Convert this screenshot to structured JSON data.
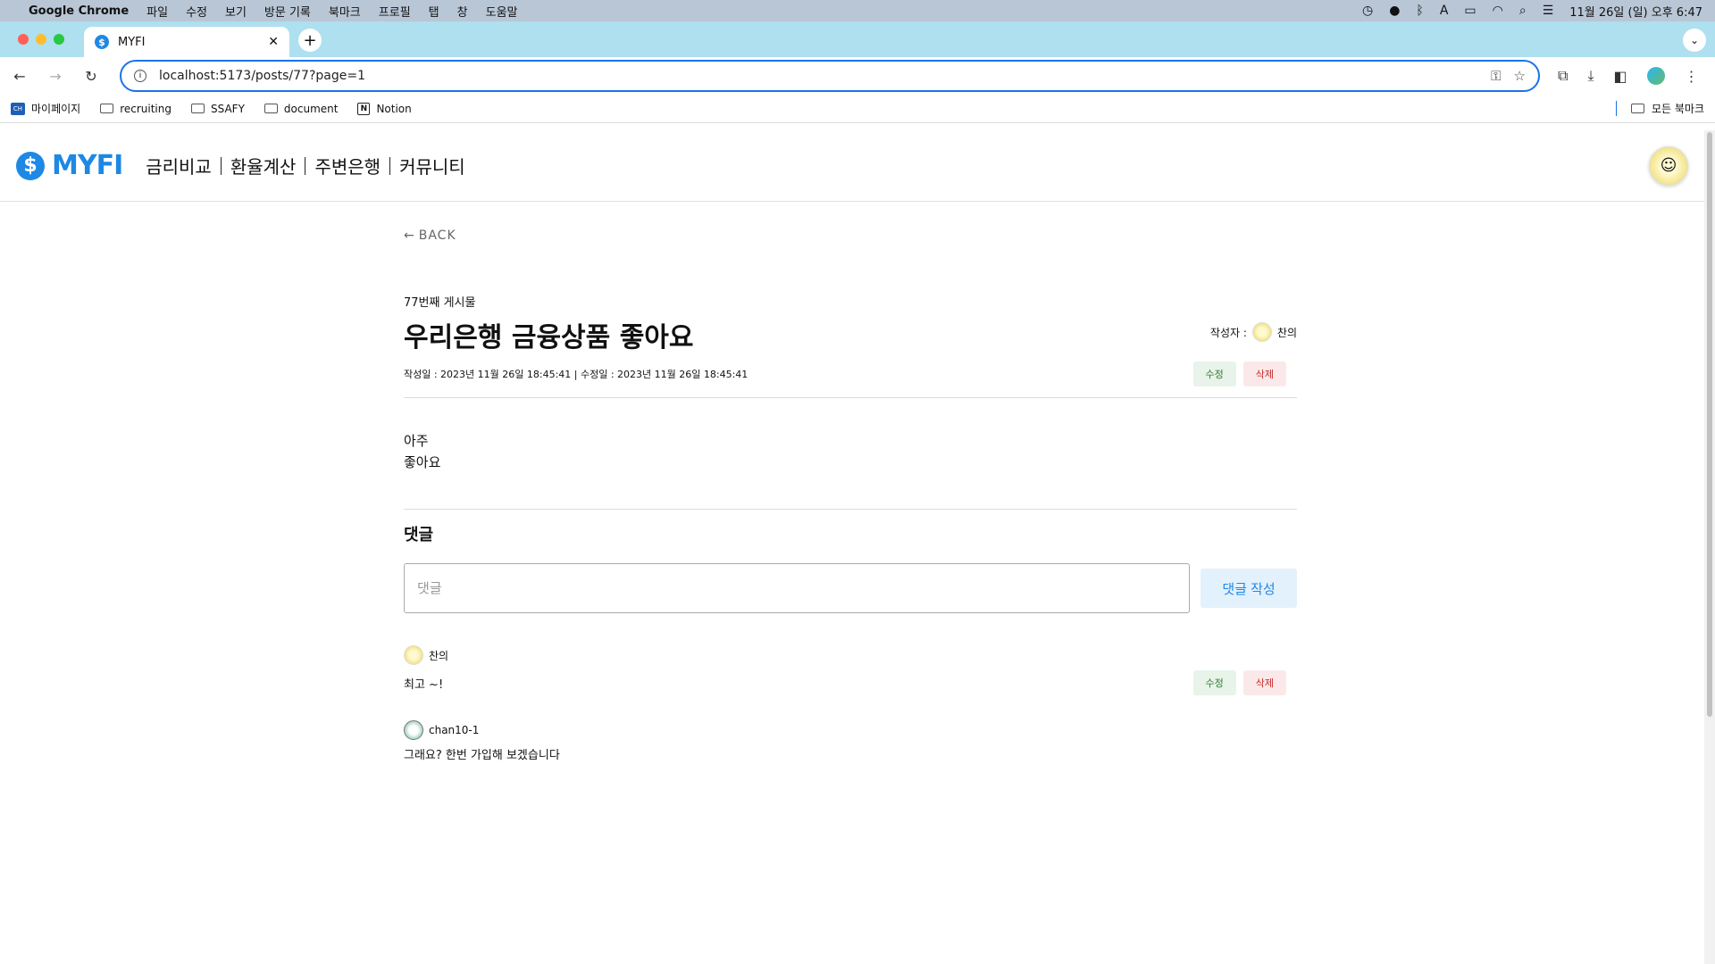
{
  "menubar": {
    "app": "Google Chrome",
    "items": [
      "파일",
      "수정",
      "보기",
      "방문 기록",
      "북마크",
      "프로필",
      "탭",
      "창",
      "도움말"
    ],
    "clock": "11월 26일 (일) 오후 6:47"
  },
  "tab": {
    "title": "MYFI"
  },
  "address": {
    "url": "localhost:5173/posts/77?page=1"
  },
  "bookmarks": {
    "items": [
      {
        "label": "마이페이지",
        "icon": "site-logo-icon"
      },
      {
        "label": "recruiting",
        "icon": "folder-icon"
      },
      {
        "label": "SSAFY",
        "icon": "folder-icon"
      },
      {
        "label": "document",
        "icon": "folder-icon"
      },
      {
        "label": "Notion",
        "icon": "notion-icon"
      }
    ],
    "all_bookmarks": "모든 북마크"
  },
  "site": {
    "brand": "MYFI",
    "nav": [
      "금리비교",
      "환율계산",
      "주변은행",
      "커뮤니티"
    ]
  },
  "post": {
    "back_label": "BACK",
    "number_label": "77번째 게시물",
    "title": "우리은행 금융상품 좋아요",
    "author_label": "작성자 :",
    "author": "찬의",
    "dates": "작성일 : 2023년 11월 26일 18:45:41 | 수정일 : 2023년 11월 26일 18:45:41",
    "edit_label": "수정",
    "delete_label": "삭제",
    "body_lines": [
      "아주",
      "좋아요"
    ]
  },
  "comments": {
    "heading": "댓글",
    "input_placeholder": "댓글",
    "submit_label": "댓글 작성",
    "items": [
      {
        "author": "찬의",
        "text": "최고 ~!",
        "edit_label": "수정",
        "delete_label": "삭제"
      },
      {
        "author": "chan10-1",
        "text": "그래요? 한번 가입해 보겠습니다"
      }
    ]
  },
  "colors": {
    "brand": "#1e88e5",
    "tabstrip": "#aee0ef",
    "edit": "#2e7d32",
    "delete": "#c62828"
  }
}
